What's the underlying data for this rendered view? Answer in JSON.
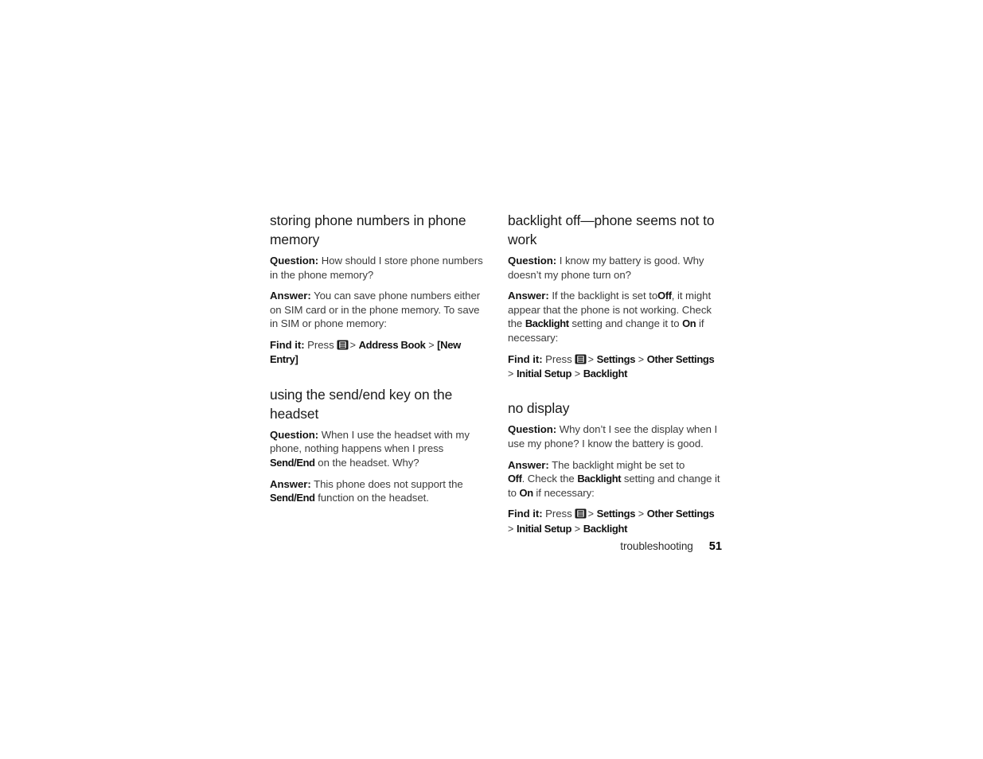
{
  "page": {
    "footer_section": "troubleshooting",
    "footer_page_number": "51",
    "icon_name": "menu-key-icon"
  },
  "columns": {
    "left": {
      "sections": [
        {
          "heading": "storing phone numbers in phone memory",
          "question_label": "Question:",
          "question_text": "How should I store phone numbers in the phone memory?",
          "answer_label": "Answer:",
          "answer_text": "You can save phone numbers either on SIM card or in the phone memory. To save in SIM or phone memory:",
          "finder_label": "Find it:",
          "finder_press": "Press",
          "finder_path": [
            "Address Book",
            "[New Entry]"
          ]
        },
        {
          "heading": "using the send/end key on the headset",
          "question_label": "Question:",
          "question_text_a": "When I use the headset with my phone, nothing happens when I press",
          "question_key": "Send/End",
          "question_text_b": "on the headset. Why?",
          "answer_label": "Answer:",
          "answer_text_a": "This phone does not support the",
          "answer_key": "Send/End",
          "answer_text_b": "function on the headset."
        }
      ]
    },
    "right": {
      "sections": [
        {
          "heading": "backlight off—phone seems not to work",
          "question_label": "Question:",
          "question_text": "I know my battery is good. Why doesn’t my phone turn on?",
          "answer_label": "Answer:",
          "answer_text_a": "If the backlight is set to",
          "answer_key_off": "Off",
          "answer_text_b": ", it might appear that the phone is not working. Check the",
          "answer_key_backlight": "Backlight",
          "answer_text_c": "setting and change it to",
          "answer_key_on": "On",
          "answer_text_d": "if necessary:",
          "finder_label": "Find it:",
          "finder_press": "Press",
          "finder_path": [
            "Settings",
            "Other Settings",
            "Initial Setup",
            "Backlight"
          ]
        },
        {
          "heading": "no display",
          "question_label": "Question:",
          "question_text": "Why don’t I see the display when I use my phone? I know the battery is good.",
          "answer_label": "Answer:",
          "answer_text_a": "The backlight might be set to",
          "answer_key_off": "Off",
          "answer_text_b": ". Check the",
          "answer_key_backlight": "Backlight",
          "answer_text_c": "setting and change it to",
          "answer_key_on": "On",
          "answer_text_d": "if necessary:",
          "finder_label": "Find it:",
          "finder_press": "Press",
          "finder_path": [
            "Settings",
            "Other Settings",
            "Initial Setup",
            "Backlight"
          ]
        }
      ]
    }
  }
}
